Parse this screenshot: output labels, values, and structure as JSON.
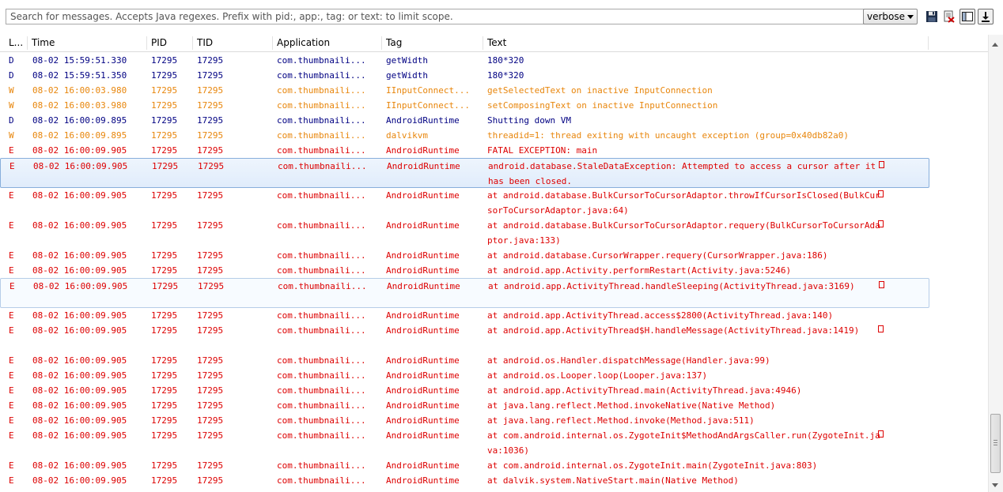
{
  "search": {
    "placeholder": "Search for messages. Accepts Java regexes. Prefix with pid:, app:, tag: or text: to limit scope."
  },
  "toolbar": {
    "level": "verbose",
    "icons": [
      "save-icon",
      "clear-log-icon",
      "toggle-panel-icon",
      "scroll-lock-icon"
    ]
  },
  "colors": {
    "debug": "#000082",
    "warning": "#e8860c",
    "error": "#dd0000",
    "selection": "#87aedb"
  },
  "columns": [
    "L...",
    "Time",
    "PID",
    "TID",
    "Application",
    "Tag",
    "Text"
  ],
  "rows": [
    {
      "level": "D",
      "time": "08-02 15:59:51.330",
      "pid": "17295",
      "tid": "17295",
      "app": "com.thumbnaili...",
      "tag": "getWidth",
      "text": "180*320"
    },
    {
      "level": "D",
      "time": "08-02 15:59:51.350",
      "pid": "17295",
      "tid": "17295",
      "app": "com.thumbnaili...",
      "tag": "getWidth",
      "text": "180*320"
    },
    {
      "level": "W",
      "time": "08-02 16:00:03.980",
      "pid": "17295",
      "tid": "17295",
      "app": "com.thumbnaili...",
      "tag": "IInputConnect...",
      "text": "getSelectedText on inactive InputConnection"
    },
    {
      "level": "W",
      "time": "08-02 16:00:03.980",
      "pid": "17295",
      "tid": "17295",
      "app": "com.thumbnaili...",
      "tag": "IInputConnect...",
      "text": "setComposingText on inactive InputConnection"
    },
    {
      "level": "D",
      "time": "08-02 16:00:09.895",
      "pid": "17295",
      "tid": "17295",
      "app": "com.thumbnaili...",
      "tag": "AndroidRuntime",
      "text": "Shutting down VM"
    },
    {
      "level": "W",
      "time": "08-02 16:00:09.895",
      "pid": "17295",
      "tid": "17295",
      "app": "com.thumbnaili...",
      "tag": "dalvikvm",
      "text": "threadid=1: thread exiting with uncaught exception (group=0x40db82a0)"
    },
    {
      "level": "E",
      "time": "08-02 16:00:09.905",
      "pid": "17295",
      "tid": "17295",
      "app": "com.thumbnaili...",
      "tag": "AndroidRuntime",
      "text": "FATAL EXCEPTION: main"
    },
    {
      "level": "E",
      "time": "08-02 16:00:09.905",
      "pid": "17295",
      "tid": "17295",
      "app": "com.thumbnaili...",
      "tag": "AndroidRuntime",
      "text": "android.database.StaleDataException: Attempted to access a cursor after it has been closed.",
      "lines": 2,
      "selected": true
    },
    {
      "level": "E",
      "time": "08-02 16:00:09.905",
      "pid": "17295",
      "tid": "17295",
      "app": "com.thumbnaili...",
      "tag": "AndroidRuntime",
      "text": "at android.database.BulkCursorToCursorAdaptor.throwIfCursorIsClosed(BulkCursorToCursorAdaptor.java:64)",
      "lines": 2
    },
    {
      "level": "E",
      "time": "08-02 16:00:09.905",
      "pid": "17295",
      "tid": "17295",
      "app": "com.thumbnaili...",
      "tag": "AndroidRuntime",
      "text": "at android.database.BulkCursorToCursorAdaptor.requery(BulkCursorToCursorAdaptor.java:133)",
      "lines": 2
    },
    {
      "level": "E",
      "time": "08-02 16:00:09.905",
      "pid": "17295",
      "tid": "17295",
      "app": "com.thumbnaili...",
      "tag": "AndroidRuntime",
      "text": "at android.database.CursorWrapper.requery(CursorWrapper.java:186)"
    },
    {
      "level": "E",
      "time": "08-02 16:00:09.905",
      "pid": "17295",
      "tid": "17295",
      "app": "com.thumbnaili...",
      "tag": "AndroidRuntime",
      "text": "at android.app.Activity.performRestart(Activity.java:5246)"
    },
    {
      "level": "E",
      "time": "08-02 16:00:09.905",
      "pid": "17295",
      "tid": "17295",
      "app": "com.thumbnaili...",
      "tag": "AndroidRuntime",
      "text": "at android.app.ActivityThread.handleSleeping(ActivityThread.java:3169)",
      "lines": 2,
      "hover": true
    },
    {
      "level": "E",
      "time": "08-02 16:00:09.905",
      "pid": "17295",
      "tid": "17295",
      "app": "com.thumbnaili...",
      "tag": "AndroidRuntime",
      "text": "at android.app.ActivityThread.access$2800(ActivityThread.java:140)"
    },
    {
      "level": "E",
      "time": "08-02 16:00:09.905",
      "pid": "17295",
      "tid": "17295",
      "app": "com.thumbnaili...",
      "tag": "AndroidRuntime",
      "text": "at android.app.ActivityThread$H.handleMessage(ActivityThread.java:1419)",
      "lines": 2
    },
    {
      "level": "E",
      "time": "08-02 16:00:09.905",
      "pid": "17295",
      "tid": "17295",
      "app": "com.thumbnaili...",
      "tag": "AndroidRuntime",
      "text": "at android.os.Handler.dispatchMessage(Handler.java:99)"
    },
    {
      "level": "E",
      "time": "08-02 16:00:09.905",
      "pid": "17295",
      "tid": "17295",
      "app": "com.thumbnaili...",
      "tag": "AndroidRuntime",
      "text": "at android.os.Looper.loop(Looper.java:137)"
    },
    {
      "level": "E",
      "time": "08-02 16:00:09.905",
      "pid": "17295",
      "tid": "17295",
      "app": "com.thumbnaili...",
      "tag": "AndroidRuntime",
      "text": "at android.app.ActivityThread.main(ActivityThread.java:4946)"
    },
    {
      "level": "E",
      "time": "08-02 16:00:09.905",
      "pid": "17295",
      "tid": "17295",
      "app": "com.thumbnaili...",
      "tag": "AndroidRuntime",
      "text": "at java.lang.reflect.Method.invokeNative(Native Method)"
    },
    {
      "level": "E",
      "time": "08-02 16:00:09.905",
      "pid": "17295",
      "tid": "17295",
      "app": "com.thumbnaili...",
      "tag": "AndroidRuntime",
      "text": "at java.lang.reflect.Method.invoke(Method.java:511)"
    },
    {
      "level": "E",
      "time": "08-02 16:00:09.905",
      "pid": "17295",
      "tid": "17295",
      "app": "com.thumbnaili...",
      "tag": "AndroidRuntime",
      "text": "at com.android.internal.os.ZygoteInit$MethodAndArgsCaller.run(ZygoteInit.java:1036)",
      "lines": 2
    },
    {
      "level": "E",
      "time": "08-02 16:00:09.905",
      "pid": "17295",
      "tid": "17295",
      "app": "com.thumbnaili...",
      "tag": "AndroidRuntime",
      "text": "at com.android.internal.os.ZygoteInit.main(ZygoteInit.java:803)"
    },
    {
      "level": "E",
      "time": "08-02 16:00:09.905",
      "pid": "17295",
      "tid": "17295",
      "app": "com.thumbnaili...",
      "tag": "AndroidRuntime",
      "text": "at dalvik.system.NativeStart.main(Native Method)"
    }
  ]
}
